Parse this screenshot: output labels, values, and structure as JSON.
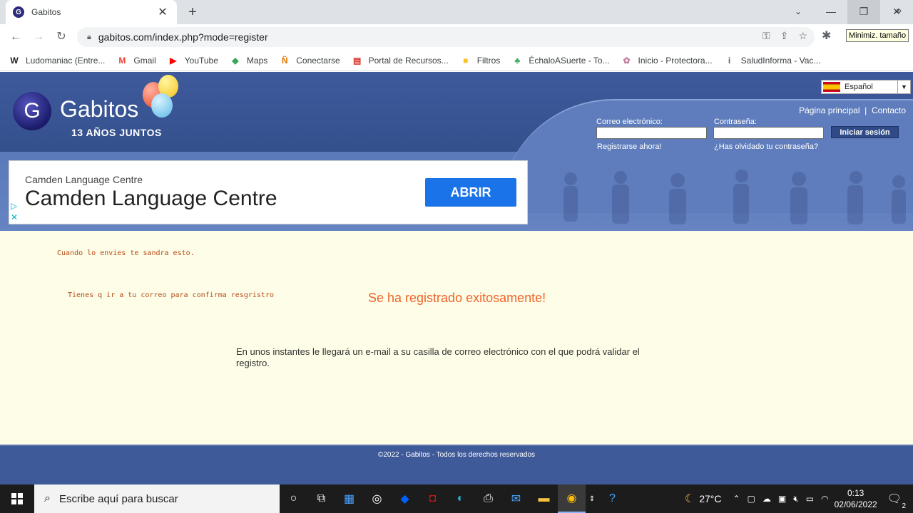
{
  "browser": {
    "tab_title": "Gabitos",
    "tab_favicon": "G",
    "new_tab": "+",
    "url": "gabitos.com/index.php?mode=register",
    "tooltip": "Minimiz. tamaño",
    "window_controls": {
      "minimize": "—",
      "restore": "❐",
      "close": "✕"
    },
    "nav": {
      "back": "←",
      "forward": "→",
      "reload": "↻"
    }
  },
  "bookmarks": [
    {
      "label": "Ludomaniac (Entre...",
      "icon": "W",
      "color": "#202124"
    },
    {
      "label": "Gmail",
      "icon": "M",
      "color": "#ea4335"
    },
    {
      "label": "YouTube",
      "icon": "▶",
      "color": "#ff0000"
    },
    {
      "label": "Maps",
      "icon": "◆",
      "color": "#34a853"
    },
    {
      "label": "Conectarse",
      "icon": "Ñ",
      "color": "#e37400"
    },
    {
      "label": "Portal de Recursos...",
      "icon": "▤",
      "color": "#d93025"
    },
    {
      "label": "Filtros",
      "icon": "■",
      "color": "#fbc02d"
    },
    {
      "label": "ÉchaloASuerte - To...",
      "icon": "♣",
      "color": "#34a853"
    },
    {
      "label": "Inicio - Protectora...",
      "icon": "✿",
      "color": "#c27ba0"
    },
    {
      "label": "SaludInforma - Vac...",
      "icon": "i",
      "color": "#5f6368"
    }
  ],
  "bookmarks_more": "»",
  "site": {
    "logo_letter": "G",
    "logo_name": "Gabitos",
    "logo_tagline": "13 AÑOS JUNTOS",
    "language": "Español",
    "links": {
      "home": "Página principal",
      "separator": "|",
      "contact": "Contacto"
    },
    "login": {
      "email_label": "Correo electrónico:",
      "password_label": "Contraseña:",
      "submit": "Iniciar sesión",
      "register": "Registrarse ahora!",
      "forgot": "¿Has olvidado tu contraseña?"
    },
    "ad": {
      "small_title": "Camden Language Centre",
      "big_title": "Camden Language Centre",
      "button": "ABRIR"
    },
    "notes": [
      "Cuando lo envies te sandra esto.",
      "Tienes q ir a tu correo para confirma resgristro"
    ],
    "success": "Se ha registrado exitosamente!",
    "info": "En unos instantes le llegará un e-mail a su casilla de correo electrónico con el que podrá validar el registro.",
    "footer": "©2022 - Gabitos - Todos los derechos reservados"
  },
  "taskbar": {
    "search_placeholder": "Escribe aquí para buscar",
    "weather": "27°C",
    "time": "0:13",
    "date": "02/06/2022",
    "notifications": "2"
  }
}
